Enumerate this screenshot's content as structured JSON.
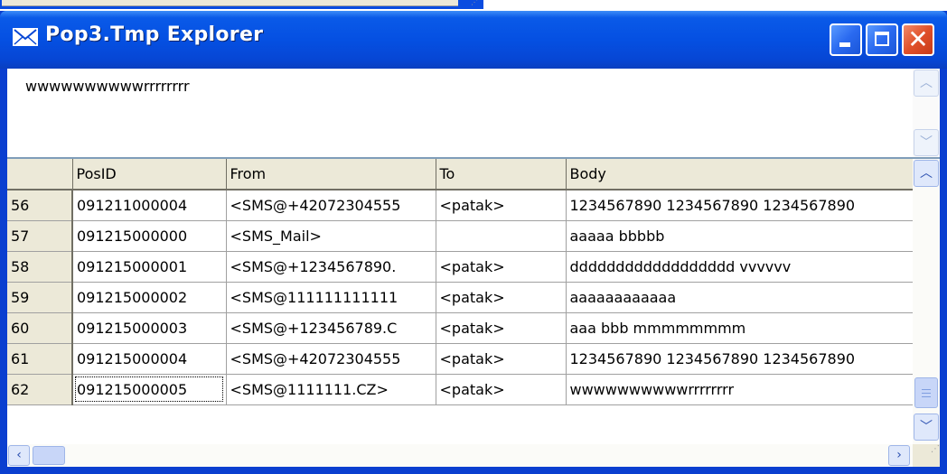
{
  "window": {
    "title": "Pop3.Tmp  Explorer",
    "icon": "envelope-icon",
    "controls": {
      "minimize": "minimize-icon",
      "maximize": "maximize-icon",
      "close": "close-icon"
    }
  },
  "memo": {
    "text": "wwwwwwwwwwrrrrrrrr"
  },
  "grid": {
    "columns": [
      "",
      "PosID",
      "From",
      "To",
      "Body"
    ],
    "rows": [
      {
        "n": "56",
        "posid": "091211000004",
        "from": "<SMS@+42072304555",
        "to": "<patak>",
        "body": "1234567890 1234567890 1234567890"
      },
      {
        "n": "57",
        "posid": "091215000000",
        "from": "<SMS_Mail>",
        "to": "",
        "body": "aaaaa bbbbb"
      },
      {
        "n": "58",
        "posid": "091215000001",
        "from": "<SMS@+1234567890.",
        "to": "<patak>",
        "body": "dddddddddddddddddd  vvvvvv"
      },
      {
        "n": "59",
        "posid": "091215000002",
        "from": "<SMS@111111111111",
        "to": "<patak>",
        "body": "aaaaaaaaaaaa"
      },
      {
        "n": "60",
        "posid": "091215000003",
        "from": "<SMS@+123456789.C",
        "to": "<patak>",
        "body": "aaa bbb mmmmmmmm"
      },
      {
        "n": "61",
        "posid": "091215000004",
        "from": "<SMS@+42072304555",
        "to": "<patak>",
        "body": "1234567890 1234567890 1234567890"
      },
      {
        "n": "62",
        "posid": "091215000005",
        "from": "<SMS@1111111.CZ>",
        "to": "<patak>",
        "body": "wwwwwwwwwwrrrrrrrr"
      }
    ]
  }
}
